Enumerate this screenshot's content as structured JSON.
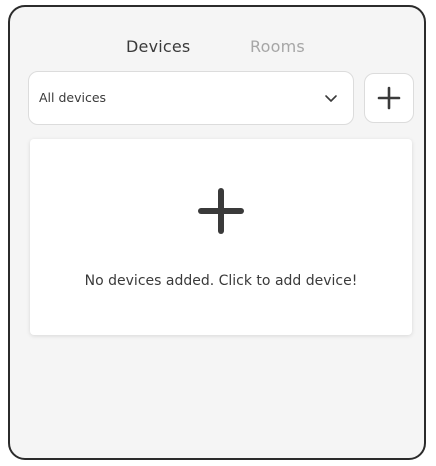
{
  "tabs": {
    "devices": "Devices",
    "rooms": "Rooms"
  },
  "filter": {
    "selected": "All devices",
    "chevron_icon": "chevron-down-icon"
  },
  "add_button": {
    "icon": "plus-icon"
  },
  "empty_state": {
    "icon": "plus-icon",
    "message": "No devices added. Click to add device!"
  },
  "colors": {
    "active_tab": "#3a3a3a",
    "inactive_tab": "#a6a6a6",
    "panel_background": "#f5f5f5",
    "icon": "#3a3a3a"
  }
}
